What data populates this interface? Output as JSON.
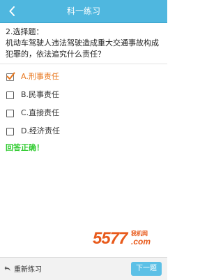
{
  "header": {
    "title": "科一练习",
    "back_icon": "back-arrow-icon"
  },
  "question": {
    "type_label": "2.选择题：",
    "text": "机动车驾驶人违法驾驶造成重大交通事故构成犯罪的，依法追究什么责任？"
  },
  "options": [
    {
      "label": "A.刑事责任",
      "checked": true
    },
    {
      "label": "B.民事责任",
      "checked": false
    },
    {
      "label": "C.直接责任",
      "checked": false
    },
    {
      "label": "D.经济责任",
      "checked": false
    }
  ],
  "result": {
    "text": "回答正确！",
    "color": "#2fcb2f"
  },
  "watermark": {
    "text": "5577.com",
    "sub": "我机网"
  },
  "footer": {
    "restart_label": "重新练习",
    "next_label": "下一题"
  },
  "colors": {
    "accent": "#4fb7df",
    "selected_option": "#e8751a",
    "check_mark": "#e8751a"
  }
}
